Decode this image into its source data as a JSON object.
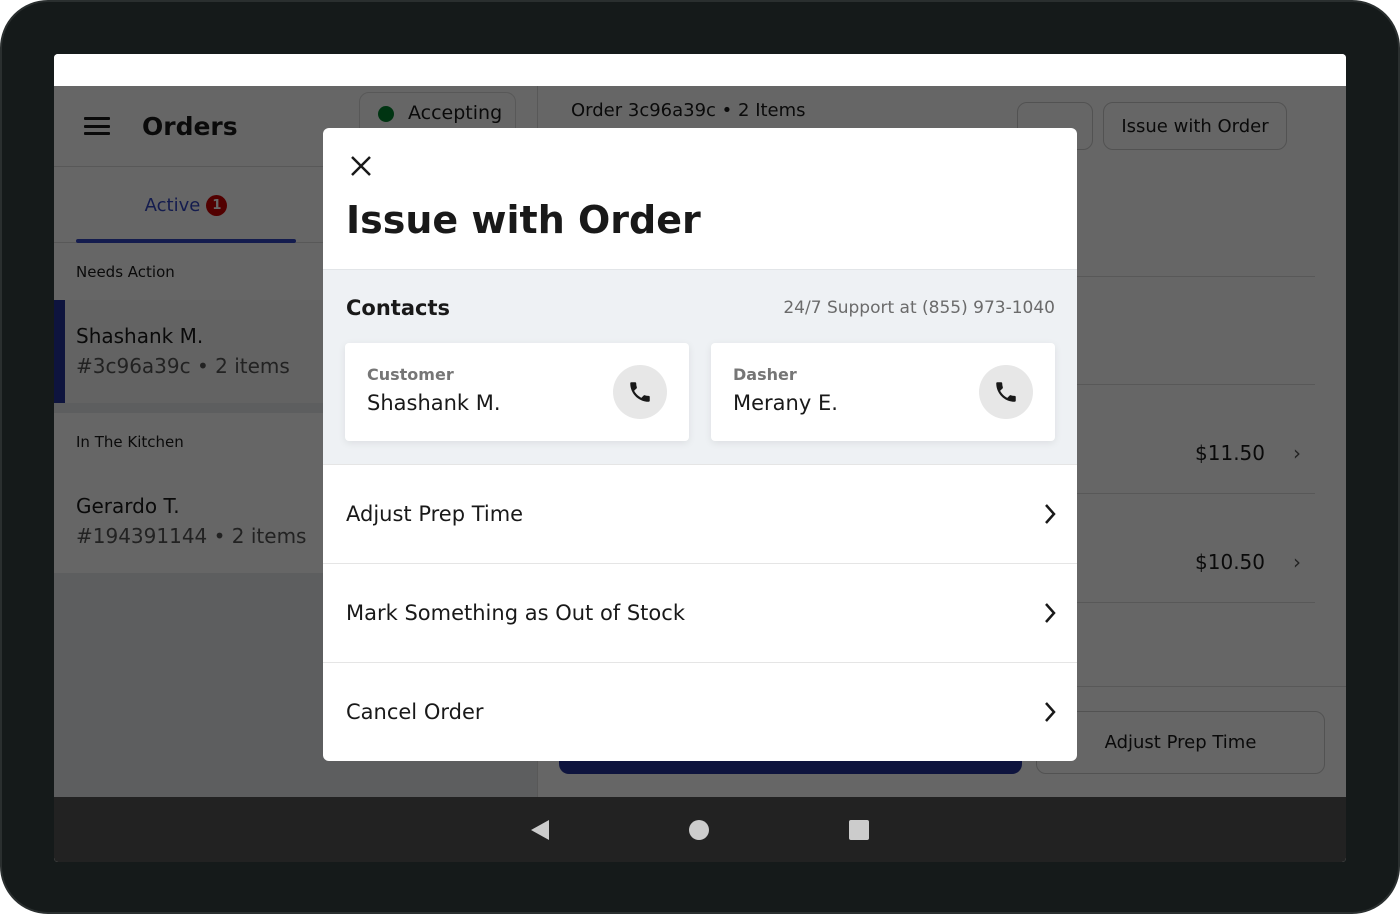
{
  "sidebar": {
    "title": "Orders",
    "status": "Accepting",
    "status_color": "#00832d",
    "tab_active": "Active",
    "tab_badge": "1",
    "sections": [
      {
        "label": "Needs Action",
        "orders": [
          {
            "name": "Shashank M.",
            "meta": "#3c96a39c • 2 items"
          }
        ]
      },
      {
        "label": "In The Kitchen",
        "orders": [
          {
            "name": "Gerardo T.",
            "meta": "#194391144 • 2 items"
          }
        ]
      }
    ]
  },
  "main": {
    "title": "Order 3c96a39c • 2 Items",
    "issue_button": "Issue with Order",
    "prices": [
      "$11.50",
      "$10.50"
    ],
    "adjust_prep_button": "Adjust Prep Time"
  },
  "modal": {
    "title": "Issue with Order",
    "contacts_title": "Contacts",
    "support": "24/7 Support at (855) 973-1040",
    "contacts": [
      {
        "role": "Customer",
        "name": "Shashank M."
      },
      {
        "role": "Dasher",
        "name": "Merany E."
      }
    ],
    "actions": [
      "Adjust Prep Time",
      "Mark Something as Out of Stock",
      "Cancel Order"
    ]
  },
  "colors": {
    "accent": "#3347c4",
    "badge": "#cc0000",
    "primary_button": "#23339a"
  }
}
